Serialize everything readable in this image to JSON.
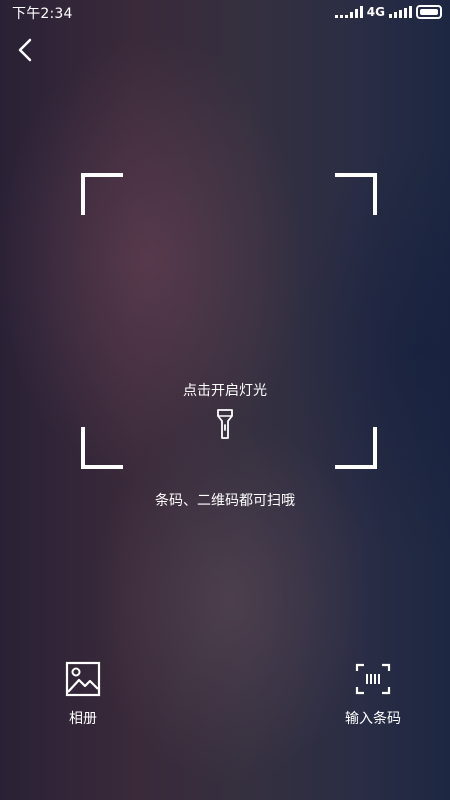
{
  "status_bar": {
    "time": "下午2:34",
    "network": "4G"
  },
  "scanner": {
    "flashlight_label": "点击开启灯光",
    "hint": "条码、二维码都可扫哦"
  },
  "bottom": {
    "album_label": "相册",
    "barcode_label": "输入条码"
  },
  "icons": {
    "back": "chevron-left-icon",
    "flashlight": "flashlight-icon",
    "album": "image-icon",
    "barcode": "barcode-scan-icon"
  }
}
